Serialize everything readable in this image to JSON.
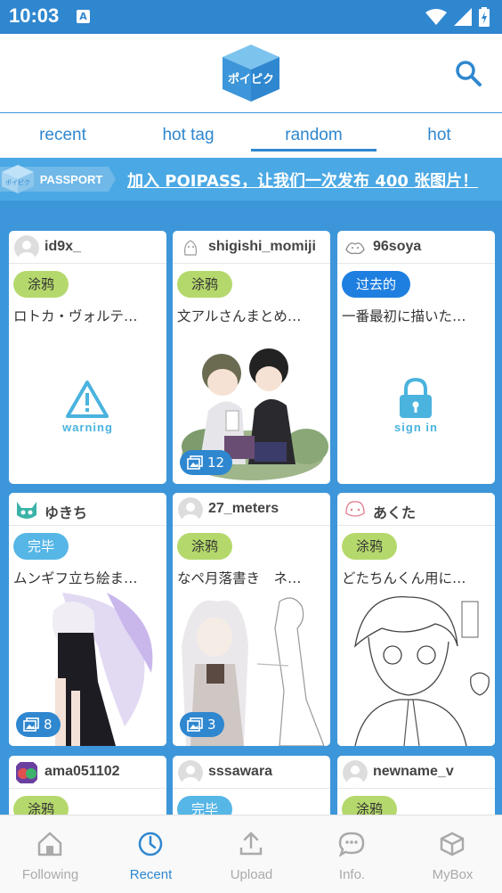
{
  "status": {
    "time": "10:03",
    "a_icon_letter": "A"
  },
  "header": {
    "logo_text": "ポイピク"
  },
  "tabs": [
    {
      "label": "recent",
      "active": false
    },
    {
      "label": "hot tag",
      "active": false
    },
    {
      "label": "random",
      "active": true
    },
    {
      "label": "hot",
      "active": false
    }
  ],
  "banner": {
    "badge_text": "PASSPORT",
    "badge_logo": "ポイピク",
    "text": "加入 POIPASS，让我们一次发布 400 张图片！"
  },
  "cards": [
    {
      "user": "id9x_",
      "category": "涂鸦",
      "category_style": "green",
      "desc": "ロトカ・ヴォルテ…",
      "overlay": "warning",
      "overlay_label": "warning",
      "count": null
    },
    {
      "user": "shigishi_momiji",
      "category": "涂鸦",
      "category_style": "green",
      "desc": "文アルさんまとめ…",
      "overlay": "image",
      "count": "12"
    },
    {
      "user": "96soya",
      "category": "过去的",
      "category_style": "blue",
      "desc": "一番最初に描いた…",
      "overlay": "signin",
      "overlay_label": "sign in",
      "count": null
    },
    {
      "user": "ゆきち",
      "category": "完毕",
      "category_style": "lightblue",
      "desc": "ムンギフ立ち絵ま…",
      "overlay": "image",
      "count": "8"
    },
    {
      "user": "27_meters",
      "category": "涂鸦",
      "category_style": "green",
      "desc": "なペ月落書き　ネ…",
      "overlay": "image",
      "count": "3"
    },
    {
      "user": "あくた",
      "category": "涂鸦",
      "category_style": "green",
      "desc": "どたちんくん用に…",
      "overlay": "image",
      "count": null
    },
    {
      "user": "ama051102",
      "category": "涂鸦",
      "category_style": "green"
    },
    {
      "user": "sssawara",
      "category": "完毕",
      "category_style": "lightblue"
    },
    {
      "user": "newname_v",
      "category": "涂鸦",
      "category_style": "green"
    }
  ],
  "bottom_nav": [
    {
      "label": "Following",
      "icon": "home-icon",
      "active": false
    },
    {
      "label": "Recent",
      "icon": "clock-icon",
      "active": true
    },
    {
      "label": "Upload",
      "icon": "upload-icon",
      "active": false
    },
    {
      "label": "Info.",
      "icon": "chat-icon",
      "active": false
    },
    {
      "label": "MyBox",
      "icon": "box-icon",
      "active": false
    }
  ],
  "colors": {
    "primary": "#2f87cf",
    "background": "#3d96d9",
    "green_tag": "#b5d86c",
    "blue_tag": "#1e7fe0",
    "lightblue_tag": "#56b6e6"
  }
}
